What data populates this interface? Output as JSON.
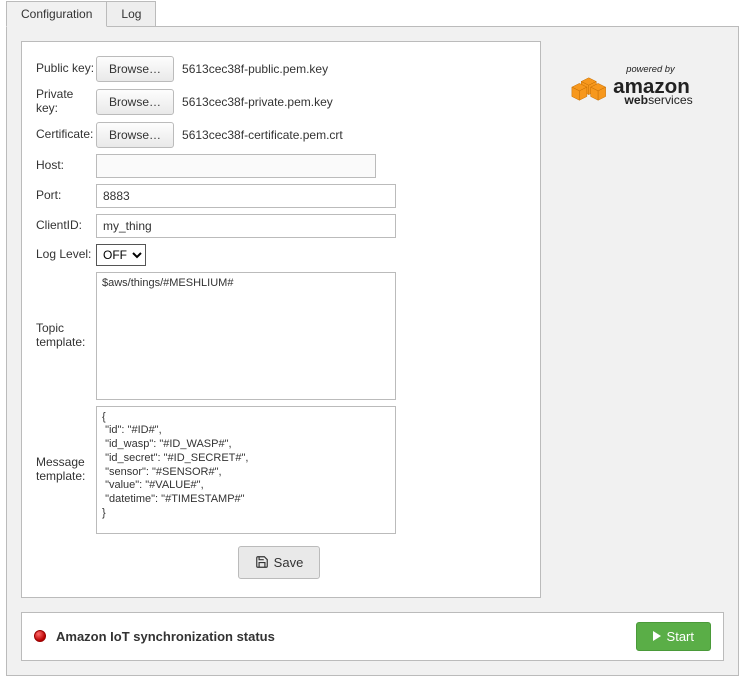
{
  "tabs": {
    "config": "Configuration",
    "log": "Log"
  },
  "labels": {
    "public_key": "Public key:",
    "private_key": "Private key:",
    "certificate": "Certificate:",
    "host": "Host:",
    "port": "Port:",
    "client_id": "ClientID:",
    "log_level": "Log Level:",
    "topic_template": "Topic template:",
    "message_template": "Message template:"
  },
  "buttons": {
    "browse": "Browse…",
    "save": "Save",
    "start": "Start"
  },
  "files": {
    "public_key": "5613cec38f-public.pem.key",
    "private_key": "5613cec38f-private.pem.key",
    "certificate": "5613cec38f-certificate.pem.crt"
  },
  "fields": {
    "host": "",
    "port": "8883",
    "client_id": "my_thing",
    "log_level": "OFF",
    "topic_template": "$aws/things/#MESHLIUM#",
    "message_template": "{\n \"id\": \"#ID#\",\n \"id_wasp\": \"#ID_WASP#\",\n \"id_secret\": \"#ID_SECRET#\",\n \"sensor\": \"#SENSOR#\",\n \"value\": \"#VALUE#\",\n \"datetime\": \"#TIMESTAMP#\"\n}"
  },
  "status": {
    "text": "Amazon IoT synchronization status"
  },
  "logo": {
    "powered_by": "powered by",
    "brand": "amazon",
    "sub": "webservices"
  }
}
